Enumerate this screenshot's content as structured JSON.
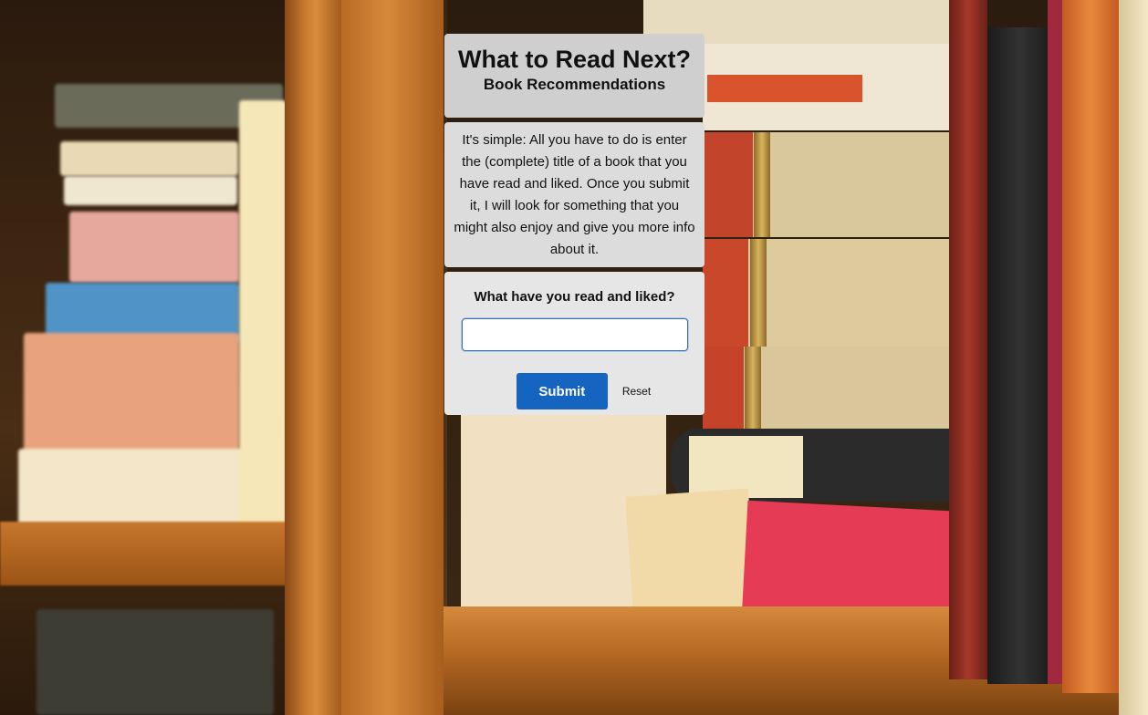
{
  "header": {
    "title": "What to Read Next?",
    "subtitle": "Book Recommendations"
  },
  "intro": {
    "text": "It's simple: All you have to do is enter the (complete) title of a book that you have read and liked. Once you submit it, I will look for something that you might also enjoy and give you more info about it."
  },
  "form": {
    "question": "What have you read and liked?",
    "input_value": "",
    "input_placeholder": "",
    "submit_label": "Submit",
    "reset_label": "Reset"
  },
  "background": {
    "description_icon": "bookshelf-photo"
  },
  "colors": {
    "submit_button": "#1565c0",
    "card_background": "#d4d4d4",
    "input_border": "#3a6fb5"
  }
}
